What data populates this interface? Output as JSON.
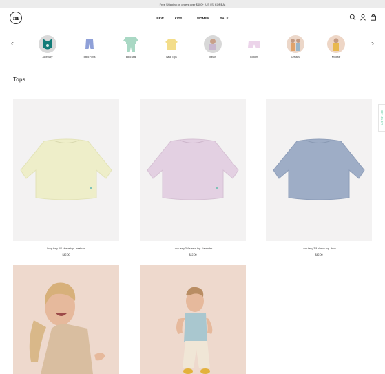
{
  "announcement": "Free Shipping on orders over $400+ (US / S. KOREA)",
  "logo": {
    "letter": "m"
  },
  "nav": [
    {
      "label": "NEW",
      "dropdown": false
    },
    {
      "label": "KIDS",
      "dropdown": true
    },
    {
      "label": "WOMEN",
      "dropdown": false
    },
    {
      "label": "SALE",
      "dropdown": false
    }
  ],
  "header_icons": [
    "search-icon",
    "account-icon",
    "bag-icon"
  ],
  "categories": [
    {
      "label": "Accessory",
      "icon": "bib-icon"
    },
    {
      "label": "Basic Pants",
      "icon": "pants-icon"
    },
    {
      "label": "Basic sets",
      "icon": "set-icon"
    },
    {
      "label": "Basic Tops",
      "icon": "tee-icon"
    },
    {
      "label": "Basics",
      "icon": "kid-photo-icon"
    },
    {
      "label": "Bottoms",
      "icon": "shorts-icon"
    },
    {
      "label": "Dresses",
      "icon": "kids-photo-icon"
    },
    {
      "label": "Knitwear",
      "icon": "knit-kid-photo-icon"
    }
  ],
  "section_title": "Tops",
  "products": [
    {
      "name": "Loop terry 3/4 sleeve top - seafoam",
      "price": "$42.00",
      "color": "#eeeec9"
    },
    {
      "name": "Loop terry 3/4 sleeve top - lavender",
      "price": "$42.00",
      "color": "#e3d0e2"
    },
    {
      "name": "Loop terry 3/4 sleeve top - blue",
      "price": "$42.00",
      "color": "#9eadc6"
    }
  ],
  "side_tab": "GET 10% OFF",
  "colors": {
    "accent": "#1bb47a",
    "image_bg": "#f3f2f2",
    "photo_bg": "#eed9cd"
  }
}
